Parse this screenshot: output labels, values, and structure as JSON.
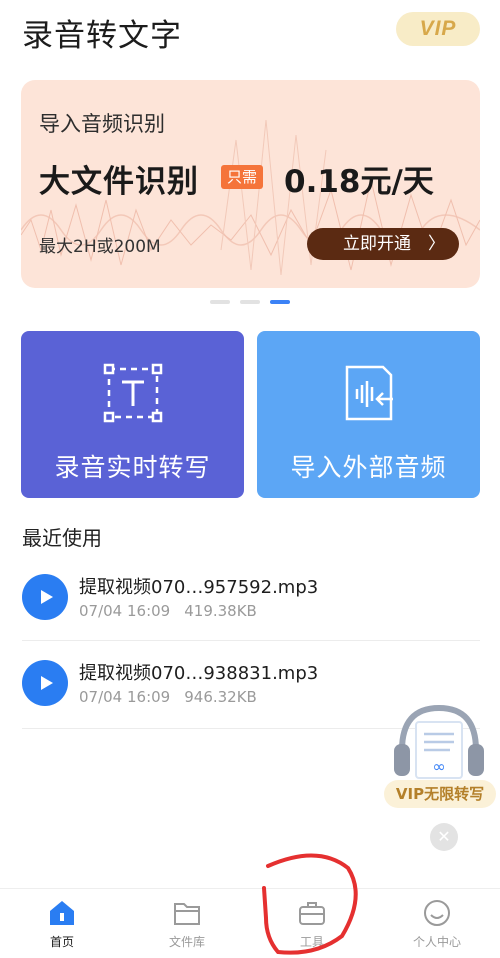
{
  "app": {
    "title": "录音转文字",
    "vip_label": "VIP"
  },
  "banner": {
    "subtitle": "导入音频识别",
    "title": "大文件识别",
    "tag": "只需",
    "price": "0.18元/天",
    "limit": "最大2H或200M",
    "cta": "立即开通",
    "page_count": 3,
    "active_page": 3
  },
  "actions": {
    "record_label": "录音实时转写",
    "import_label": "导入外部音频"
  },
  "recent": {
    "title": "最近使用",
    "items": [
      {
        "name": "提取视频070…957592.mp3",
        "date": "07/04 16:09",
        "size": "419.38KB"
      },
      {
        "name": "提取视频070…938831.mp3",
        "date": "07/04 16:09",
        "size": "946.32KB"
      }
    ]
  },
  "vip_float": {
    "label": "VIP无限转写"
  },
  "tabbar": {
    "items": [
      {
        "label": "首页",
        "icon": "home-icon",
        "active": true
      },
      {
        "label": "文件库",
        "icon": "folder-icon",
        "active": false
      },
      {
        "label": "工具",
        "icon": "toolbox-icon",
        "active": false
      },
      {
        "label": "个人中心",
        "icon": "smile-icon",
        "active": false
      }
    ]
  },
  "colors": {
    "accent_blue": "#2a7df2",
    "record_card": "#5a62d6",
    "import_card": "#5ca6f5",
    "banner_bg": "#fde4d8",
    "cta_bg": "#5b2a12",
    "tag_bg": "#f5743a",
    "vip_gold": "#d7a84a",
    "annotation_red": "#e53030"
  }
}
